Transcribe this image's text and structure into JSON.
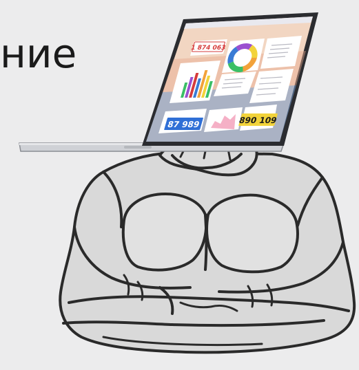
{
  "heading": "ние",
  "dashboard": {
    "metric_top": "1 874 063",
    "metric_left": "87 989",
    "metric_right": "890 109"
  },
  "colors": {
    "background": "#ececed",
    "metric_red": "#d63b3b",
    "metric_blue": "#2f6fd6",
    "metric_yellow": "#f2d33b",
    "donut_orange": "#f2a23a",
    "donut_green": "#3bbf66",
    "donut_blue": "#3a7bd5",
    "donut_purple": "#9b4fd0",
    "donut_yellow": "#f2d33b"
  },
  "icons": [
    "laptop-illustration",
    "muscular-torso-illustration"
  ]
}
